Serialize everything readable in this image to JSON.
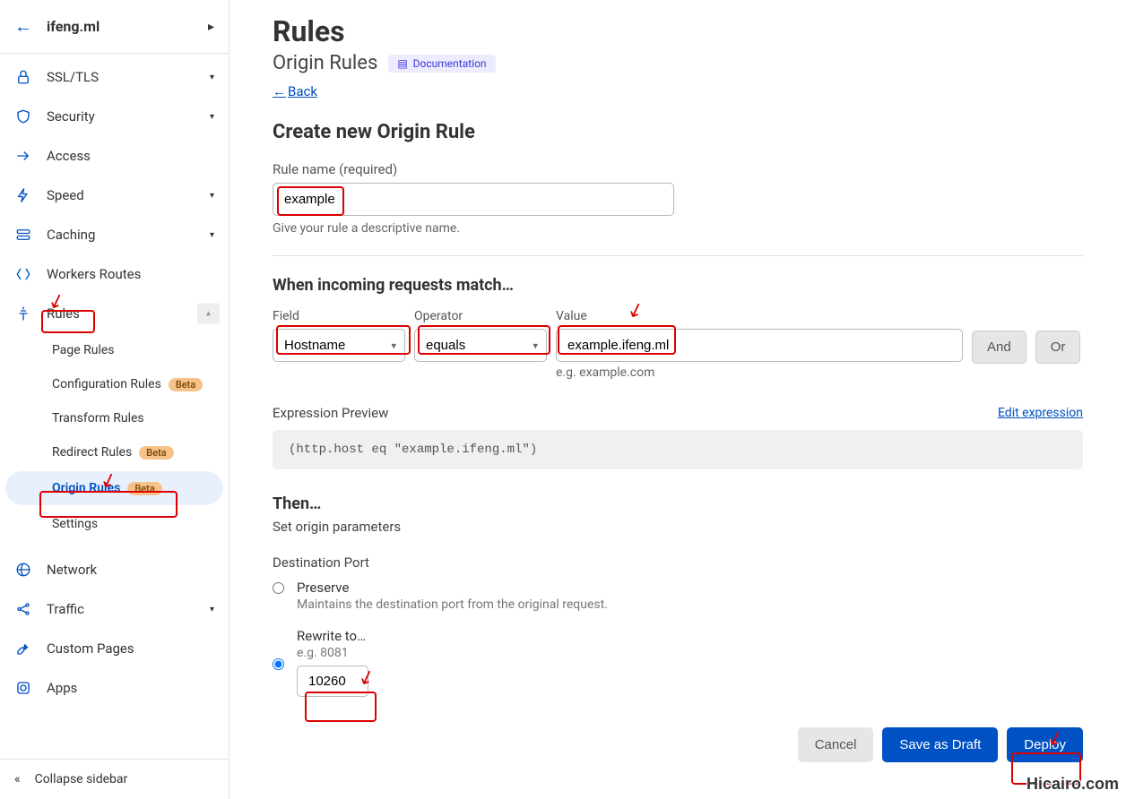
{
  "site": {
    "name": "ifeng.ml"
  },
  "sidebar": {
    "items": [
      {
        "label": "SSL/TLS"
      },
      {
        "label": "Security"
      },
      {
        "label": "Access"
      },
      {
        "label": "Speed"
      },
      {
        "label": "Caching"
      },
      {
        "label": "Workers Routes"
      },
      {
        "label": "Rules"
      },
      {
        "label": "Network"
      },
      {
        "label": "Traffic"
      },
      {
        "label": "Custom Pages"
      },
      {
        "label": "Apps"
      }
    ],
    "rules_sub": [
      {
        "label": "Page Rules"
      },
      {
        "label": "Configuration Rules",
        "badge": "Beta"
      },
      {
        "label": "Transform Rules"
      },
      {
        "label": "Redirect Rules",
        "badge": "Beta"
      },
      {
        "label": "Origin Rules",
        "badge": "Beta"
      },
      {
        "label": "Settings"
      }
    ],
    "collapse": "Collapse sidebar"
  },
  "page": {
    "title": "Rules",
    "subtitle": "Origin Rules",
    "doc_badge": "Documentation",
    "back": "Back",
    "create_heading": "Create new Origin Rule",
    "rule_name_label": "Rule name (required)",
    "rule_name_value": "example",
    "rule_name_help": "Give your rule a descriptive name.",
    "when_heading": "When incoming requests match…",
    "field_label": "Field",
    "field_value": "Hostname",
    "operator_label": "Operator",
    "operator_value": "equals",
    "value_label": "Value",
    "value_value": "example.ifeng.ml",
    "value_help": "e.g. example.com",
    "and_btn": "And",
    "or_btn": "Or",
    "expr_label": "Expression Preview",
    "edit_expr": "Edit expression",
    "expr_value": "(http.host eq \"example.ifeng.ml\")",
    "then_heading": "Then…",
    "then_sub": "Set origin parameters",
    "dest_label": "Destination Port",
    "preserve_title": "Preserve",
    "preserve_desc": "Maintains the destination port from the original request.",
    "rewrite_title": "Rewrite to…",
    "rewrite_help": "e.g. 8081",
    "port_value": "10260",
    "cancel_btn": "Cancel",
    "draft_btn": "Save as Draft",
    "deploy_btn": "Deploy"
  },
  "watermark": "Hicairo.com"
}
